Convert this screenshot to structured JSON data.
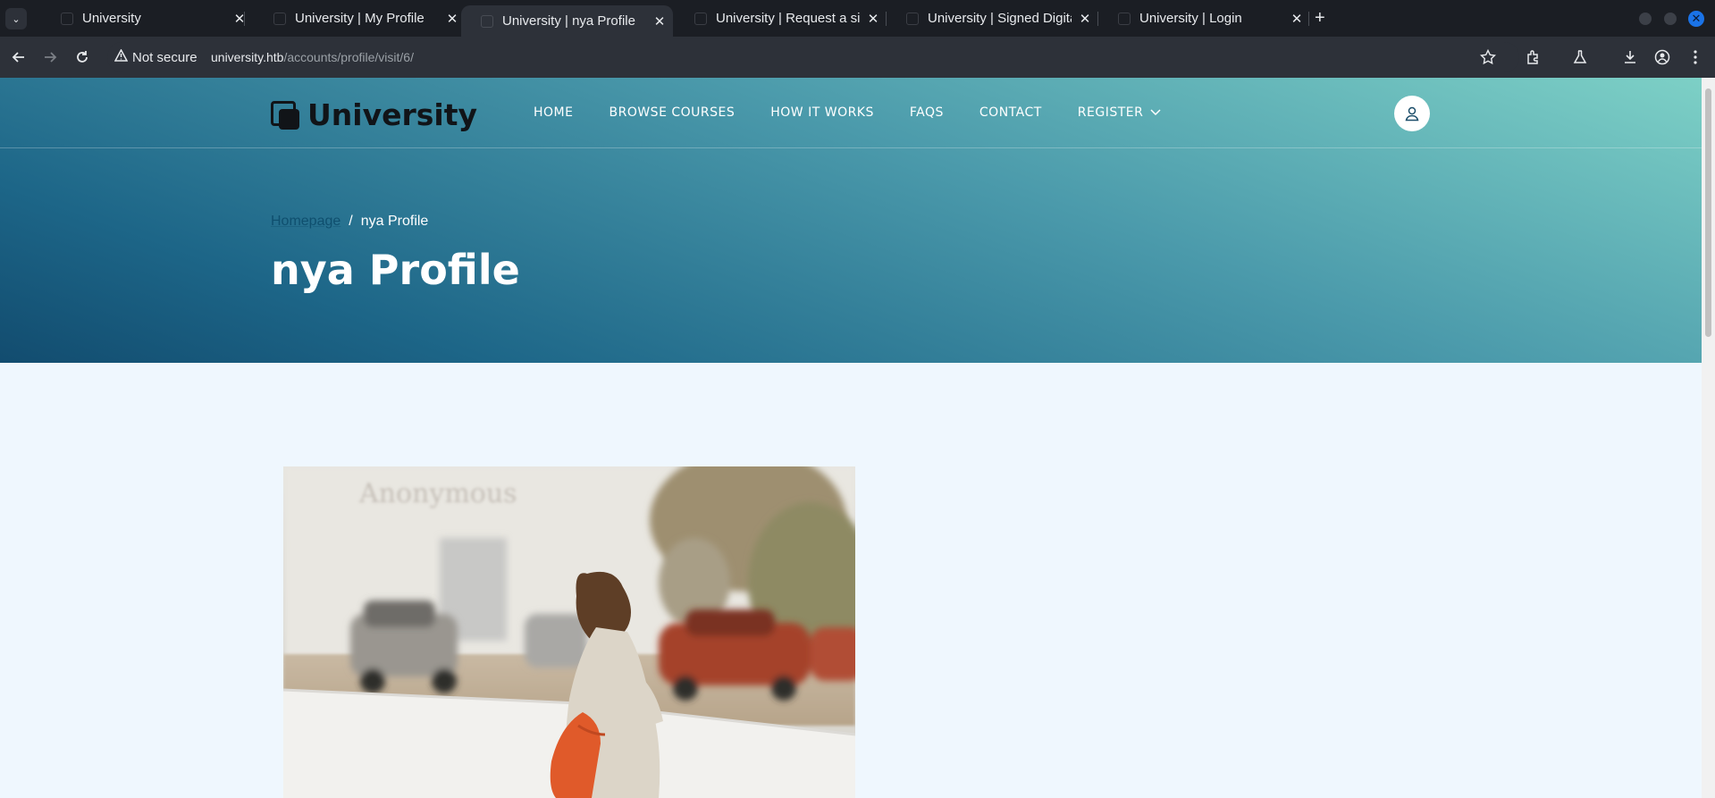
{
  "browser": {
    "tabs": [
      {
        "title": "University",
        "active": false
      },
      {
        "title": "University | My Profile",
        "active": false
      },
      {
        "title": "University | nya Profile",
        "active": true
      },
      {
        "title": "University | Request a sig",
        "active": false
      },
      {
        "title": "University | Signed Digita",
        "active": false
      },
      {
        "title": "University | Login",
        "active": false
      }
    ],
    "security_label": "Not secure",
    "url_host": "university.htb",
    "url_path": "/accounts/profile/visit/6/"
  },
  "site": {
    "logo_text": "University",
    "nav": [
      {
        "label": "HOME"
      },
      {
        "label": "BROWSE COURSES"
      },
      {
        "label": "HOW IT WORKS"
      },
      {
        "label": "FAQS"
      },
      {
        "label": "CONTACT"
      },
      {
        "label": "REGISTER",
        "has_dropdown": true
      }
    ]
  },
  "hero": {
    "breadcrumb_home": "Homepage",
    "breadcrumb_sep": "/",
    "breadcrumb_current": "nya Profile",
    "title": "nya Profile"
  },
  "photo": {
    "sign_text": "Anonymous"
  }
}
